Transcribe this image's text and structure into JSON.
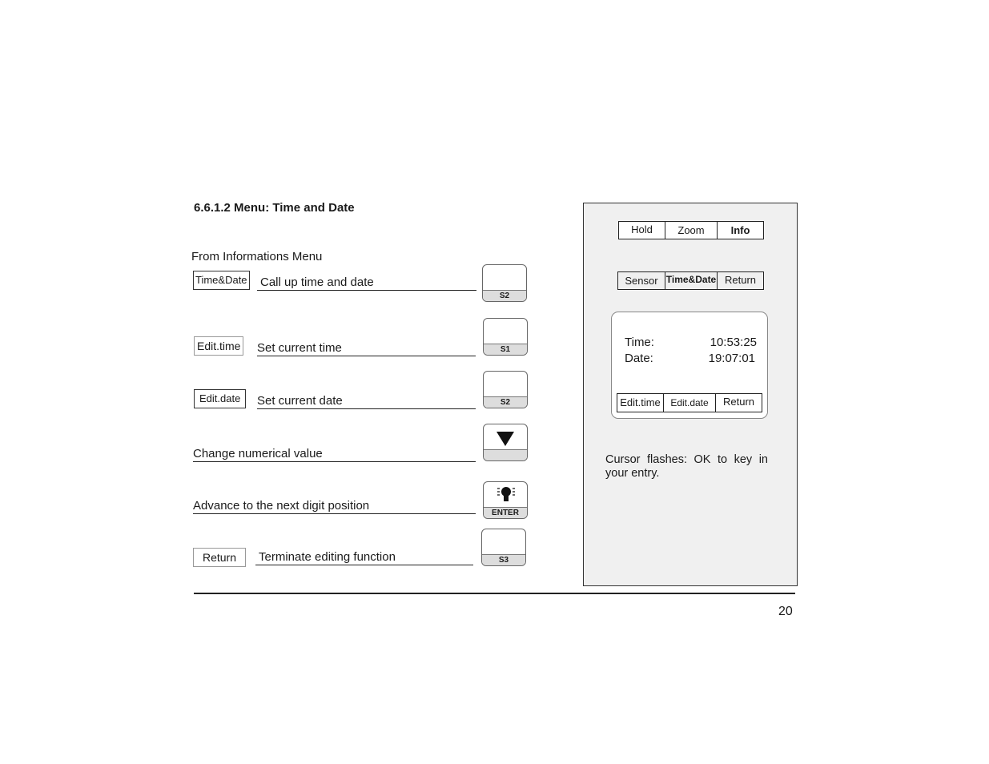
{
  "heading": "6.6.1.2  Menu:  Time and Date",
  "intro": "From Informations Menu",
  "steps": [
    {
      "softkey": "Time&Date",
      "text": "Call up time and date",
      "key": "S2"
    },
    {
      "softkey": "Edit.time",
      "text": "Set current time",
      "key": "S1"
    },
    {
      "softkey": "Edit.date",
      "text": "Set current date",
      "key": "S2"
    },
    {
      "text": "Change numerical value",
      "key_icon": "down-triangle-icon"
    },
    {
      "text": "Advance to the next digit position",
      "key": "ENTER",
      "key_icon": "lightbulb-icon"
    },
    {
      "softkey": "Return",
      "text": "Terminate editing function",
      "key": "S3"
    }
  ],
  "panel": {
    "menu1": [
      "Hold",
      "Zoom",
      "Info"
    ],
    "menu2": [
      "Sensor",
      "Time&Date",
      "Return"
    ],
    "display": {
      "time_label": "Time:",
      "time_value": "10:53:25",
      "date_label": "Date:",
      "date_value": "19:07:01",
      "menu": [
        "Edit.time",
        "Edit.date",
        "Return"
      ]
    },
    "note": "Cursor flashes: OK to key in your entry."
  },
  "page_number": "20"
}
